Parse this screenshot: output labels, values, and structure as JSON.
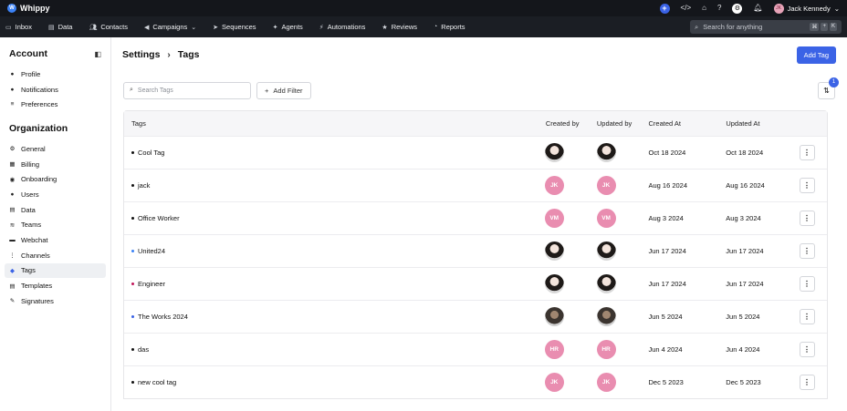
{
  "app": {
    "name": "Whippy"
  },
  "topbar": {
    "icons": [
      "plus-icon",
      "code-icon",
      "home-icon",
      "help-icon",
      "settings-icon",
      "bell-icon"
    ],
    "user": {
      "name": "Jack Kennedy"
    }
  },
  "nav": {
    "items": [
      {
        "label": "Inbox",
        "icon": "inbox-icon"
      },
      {
        "label": "Data",
        "icon": "database-icon"
      },
      {
        "label": "Contacts",
        "icon": "contacts-icon"
      },
      {
        "label": "Campaigns",
        "icon": "megaphone-icon"
      },
      {
        "label": "Sequences",
        "icon": "send-icon"
      },
      {
        "label": "Agents",
        "icon": "sparkle-icon"
      },
      {
        "label": "Automations",
        "icon": "bolt-icon"
      },
      {
        "label": "Reviews",
        "icon": "star-icon"
      },
      {
        "label": "Reports",
        "icon": "chart-icon"
      }
    ],
    "search_placeholder": "Search for anything",
    "shortcut": [
      "⌘",
      "+",
      "K"
    ]
  },
  "sidebar": {
    "account_title": "Account",
    "account_items": [
      {
        "label": "Profile",
        "icon": "person-icon"
      },
      {
        "label": "Notifications",
        "icon": "bell-icon"
      },
      {
        "label": "Preferences",
        "icon": "sliders-icon"
      }
    ],
    "org_title": "Organization",
    "org_items": [
      {
        "label": "General",
        "icon": "settings-icon"
      },
      {
        "label": "Billing",
        "icon": "grid-icon"
      },
      {
        "label": "Onboarding",
        "icon": "compass-icon"
      },
      {
        "label": "Users",
        "icon": "person-icon"
      },
      {
        "label": "Data",
        "icon": "database-icon"
      },
      {
        "label": "Teams",
        "icon": "layers-icon"
      },
      {
        "label": "Webchat",
        "icon": "chat-icon"
      },
      {
        "label": "Channels",
        "icon": "channels-icon"
      },
      {
        "label": "Tags",
        "icon": "tag-icon",
        "active": true
      },
      {
        "label": "Templates",
        "icon": "template-icon"
      },
      {
        "label": "Signatures",
        "icon": "signature-icon"
      }
    ]
  },
  "header": {
    "breadcrumb_root": "Settings",
    "breadcrumb_current": "Tags",
    "add_tag_label": "Add Tag"
  },
  "toolbar": {
    "search_placeholder": "Search Tags",
    "add_filter_label": "Add Filter",
    "sort_badge": "1"
  },
  "table": {
    "columns": [
      "Tags",
      "Created by",
      "Updated by",
      "Created At",
      "Updated At"
    ],
    "rows": [
      {
        "name": "Cool Tag",
        "dot_color": "#111111",
        "created_by": {
          "type": "photo-w",
          "initials": ""
        },
        "updated_by": {
          "type": "photo-w",
          "initials": ""
        },
        "created_at": "Oct 18 2024",
        "updated_at": "Oct 18 2024"
      },
      {
        "name": "jack",
        "dot_color": "#111111",
        "created_by": {
          "type": "initials",
          "initials": "JK"
        },
        "updated_by": {
          "type": "initials",
          "initials": "JK"
        },
        "created_at": "Aug 16 2024",
        "updated_at": "Aug 16 2024"
      },
      {
        "name": "Office Worker",
        "dot_color": "#111111",
        "created_by": {
          "type": "initials",
          "initials": "VM"
        },
        "updated_by": {
          "type": "initials",
          "initials": "VM"
        },
        "created_at": "Aug 3 2024",
        "updated_at": "Aug 3 2024"
      },
      {
        "name": "United24",
        "dot_color": "#3b82f6",
        "created_by": {
          "type": "photo-w",
          "initials": ""
        },
        "updated_by": {
          "type": "photo-w",
          "initials": ""
        },
        "created_at": "Jun 17 2024",
        "updated_at": "Jun 17 2024"
      },
      {
        "name": "Engineer",
        "dot_color": "#c2185b",
        "created_by": {
          "type": "photo-w",
          "initials": ""
        },
        "updated_by": {
          "type": "photo-w",
          "initials": ""
        },
        "created_at": "Jun 17 2024",
        "updated_at": "Jun 17 2024"
      },
      {
        "name": "The Works 2024",
        "dot_color": "#3b63e6",
        "created_by": {
          "type": "photo-m",
          "initials": ""
        },
        "updated_by": {
          "type": "photo-m",
          "initials": ""
        },
        "created_at": "Jun 5 2024",
        "updated_at": "Jun 5 2024"
      },
      {
        "name": "das",
        "dot_color": "#111111",
        "created_by": {
          "type": "initials",
          "initials": "HR"
        },
        "updated_by": {
          "type": "initials",
          "initials": "HR"
        },
        "created_at": "Jun 4 2024",
        "updated_at": "Jun 4 2024"
      },
      {
        "name": "new cool tag",
        "dot_color": "#111111",
        "created_by": {
          "type": "initials",
          "initials": "JK"
        },
        "updated_by": {
          "type": "initials",
          "initials": "JK"
        },
        "created_at": "Dec 5 2023",
        "updated_at": "Dec 5 2023"
      }
    ]
  }
}
